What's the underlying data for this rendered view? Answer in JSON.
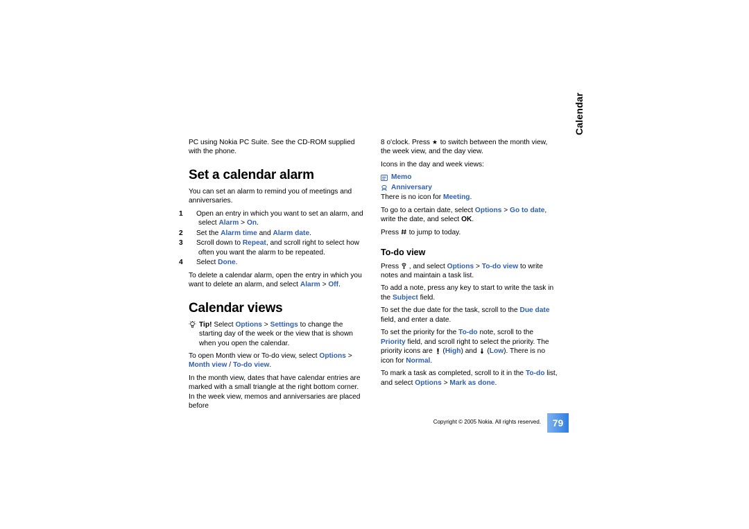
{
  "sideTab": "Calendar",
  "pageNumber": "79",
  "copyright": "Copyright © 2005 Nokia. All rights reserved.",
  "col1": {
    "topLine": "PC using Nokia PC Suite. See the CD-ROM supplied with the phone.",
    "heading1": "Set a calendar alarm",
    "intro1": "You can set an alarm to remind you of meetings and anniversaries.",
    "steps": {
      "n1": "1",
      "s1a": "Open an entry in which you want to set an alarm, and select ",
      "s1b": "Alarm",
      "s1c": " > ",
      "s1d": "On",
      "s1e": ".",
      "n2": "2",
      "s2a": "Set the ",
      "s2b": "Alarm time",
      "s2c": " and ",
      "s2d": "Alarm date",
      "s2e": ".",
      "n3": "3",
      "s3a": "Scroll down to ",
      "s3b": "Repeat",
      "s3c": ", and scroll right to select how often you want the alarm to be repeated.",
      "n4": "4",
      "s4a": "Select ",
      "s4b": "Done",
      "s4c": "."
    },
    "delete": {
      "a": "To delete a calendar alarm, open the entry in which you want to delete an alarm, and select ",
      "b": "Alarm",
      "c": " > ",
      "d": "Off",
      "e": "."
    },
    "heading2": "Calendar views",
    "tipLabel": "Tip! ",
    "tip": {
      "a": "Select ",
      "b": "Options",
      "c": " > ",
      "d": "Settings",
      "e": " to change the starting day of the week or the view that is shown when you open the calendar."
    },
    "openView": {
      "a": "To open Month view or To-do view, select ",
      "b": "Options",
      "c": " > ",
      "d": "Month view",
      "e": " / ",
      "f": "To-do view",
      "g": "."
    },
    "monthNote": "In the month view, dates that have calendar entries are marked with a small triangle at the right bottom corner. In the week view, memos and anniversaries are placed before"
  },
  "col2": {
    "topLine": "8 o'clock. Press     to switch between the month view, the week view, and the day view.",
    "iconsIntro": "Icons in the day and week views:",
    "memo": "Memo",
    "anniv": "Anniversary",
    "noIcon": {
      "a": "There is no icon for ",
      "b": "Meeting",
      "c": "."
    },
    "goDate": {
      "a": "To go to a certain date, select ",
      "b": "Options",
      "c": " > ",
      "d": "Go to date",
      "e": ", write the date, and select ",
      "f": "OK",
      "g": "."
    },
    "pressJump": {
      "a": "Press ",
      "b": " to jump to today."
    },
    "heading3": "To-do view",
    "todo1": {
      "a": "Press ",
      "b": " , and select ",
      "c": "Options",
      "d": " > ",
      "e": "To-do view",
      "f": " to write notes and maintain a task list."
    },
    "todo2": {
      "a": "To add a note, press any key to start to write the task in the ",
      "b": "Subject",
      "c": " field."
    },
    "todo3": {
      "a": "To set the due date for the task, scroll to the ",
      "b": "Due date",
      "c": " field, and enter a date."
    },
    "todo4": {
      "a": "To set the priority for the ",
      "b": "To-do",
      "c": " note, scroll to the ",
      "d": "Priority",
      "e": " field, and scroll right to select the priority. The priority icons are ",
      "f": " (",
      "g": "High",
      "h": ") and ",
      "i": " (",
      "j": "Low",
      "k": "). There is no icon for ",
      "l": "Normal",
      "m": "."
    },
    "todo5": {
      "a": "To mark a task as completed, scroll to it in the ",
      "b": "To-do",
      "c": " list, and select ",
      "d": "Options",
      "e": " > ",
      "f": "Mark as done",
      "g": "."
    }
  }
}
